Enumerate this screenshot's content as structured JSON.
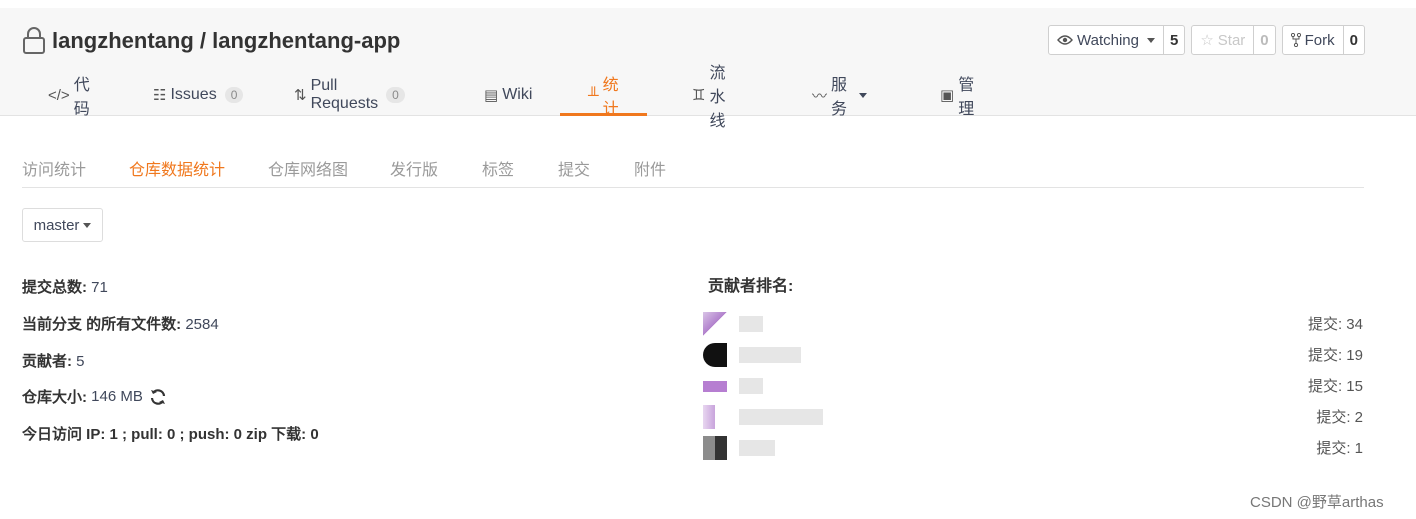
{
  "repo": {
    "owner": "langzhentang",
    "separator": " / ",
    "name": "langzhentang-app"
  },
  "actions": {
    "watching": {
      "label": "Watching",
      "count": "5"
    },
    "star": {
      "label": "Star",
      "count": "0"
    },
    "fork": {
      "label": "Fork",
      "count": "0"
    }
  },
  "tabs": [
    {
      "label": "代码",
      "icon": "code-icon"
    },
    {
      "label": "Issues",
      "badge": "0",
      "icon": "issues-icon"
    },
    {
      "label": "Pull Requests",
      "badge": "0",
      "icon": "pull-request-icon"
    },
    {
      "label": "Wiki",
      "icon": "wiki-icon"
    },
    {
      "label": "统计",
      "icon": "stats-icon"
    },
    {
      "label": "流水线",
      "icon": "pipeline-icon"
    },
    {
      "label": "服务",
      "icon": "service-icon"
    },
    {
      "label": "管理",
      "icon": "manage-icon"
    }
  ],
  "subnav": [
    "访问统计",
    "仓库数据统计",
    "仓库网络图",
    "发行版",
    "标签",
    "提交",
    "附件"
  ],
  "branch": "master",
  "stats": {
    "commits_label": "提交总数:",
    "commits_value": " 71",
    "files_label": "当前分支 的所有文件数:",
    "files_value": " 2584",
    "contributors_label": "贡献者:",
    "contributors_value": " 5",
    "size_label": "仓库大小:",
    "size_value": " 146 MB",
    "today_label": "今日访问 IP: 1 ; pull: 0 ; push: 0 zip 下载: 0"
  },
  "contributors": {
    "title": "贡献者排名:",
    "rows": [
      {
        "count": "提交: 34"
      },
      {
        "count": "提交: 19"
      },
      {
        "count": "提交: 15"
      },
      {
        "count": "提交: 2"
      },
      {
        "count": "提交: 1"
      }
    ]
  },
  "watermark": "CSDN @野草arthas",
  "colors": {
    "accent": "#f0781e",
    "text": "#40485b"
  }
}
